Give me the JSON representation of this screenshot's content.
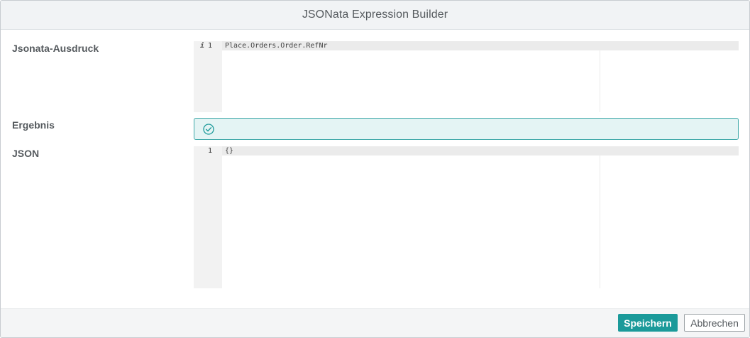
{
  "dialog": {
    "title": "JSONata Expression Builder"
  },
  "expression": {
    "label": "Jsonata-Ausdruck",
    "line_number": "1",
    "info_marker": "i",
    "code": "Place.Orders.Order.RefNr"
  },
  "result": {
    "label": "Ergebnis",
    "icon": "check-circle-icon",
    "status_color": "#3ea8a8"
  },
  "json": {
    "label": "JSON",
    "line_number": "1",
    "code": "{}"
  },
  "footer": {
    "save_label": "Speichern",
    "cancel_label": "Abbrechen",
    "accent_color": "#1b9a9a"
  }
}
